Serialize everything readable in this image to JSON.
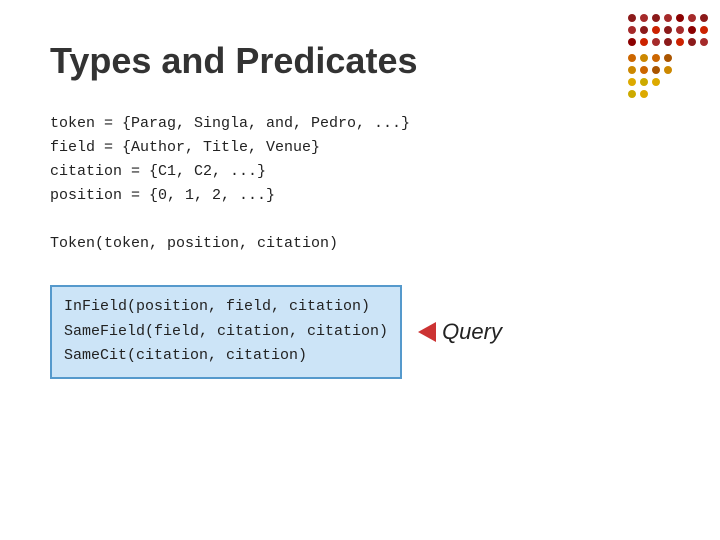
{
  "slide": {
    "title": "Types and Predicates",
    "definitions": [
      "token = {Parag, Singla, and, Pedro, ...}",
      "field = {Author, Title, Venue}",
      "citation = {C1, C2, ...}",
      "position = {0, 1, 2, ...}"
    ],
    "non_highlighted_predicate": "Token(token, position, citation)",
    "highlighted_predicates": [
      "InField(position, field, citation)",
      "SameField(field, citation, citation)",
      "SameCit(citation, citation)"
    ],
    "query_label": "Query",
    "arrow_icon": "arrow-left",
    "colors": {
      "highlight_bg": "#cce4f7",
      "highlight_border": "#5599cc",
      "arrow": "#cc3333",
      "title": "#333333",
      "text": "#222222"
    }
  }
}
